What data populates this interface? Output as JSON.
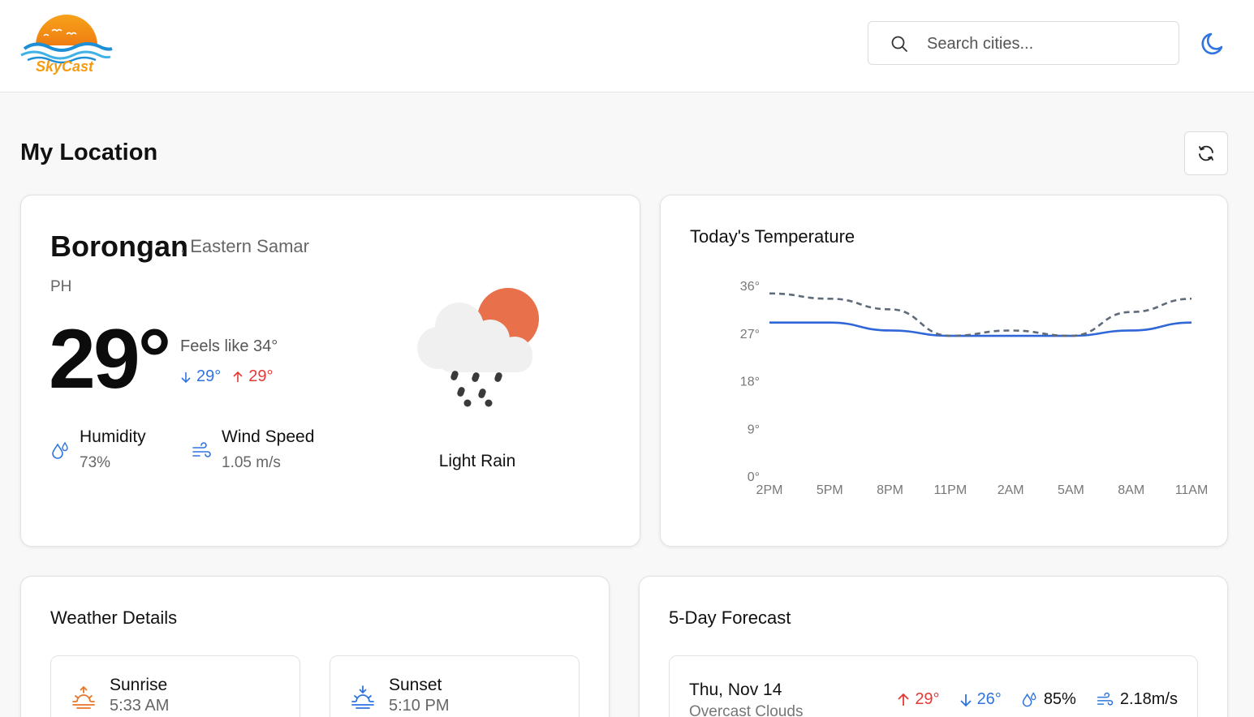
{
  "app": {
    "name": "SkyCast"
  },
  "search": {
    "placeholder": "Search cities..."
  },
  "section": {
    "title": "My Location"
  },
  "current": {
    "city": "Borongan",
    "region": ", Eastern Samar",
    "country": "PH",
    "temperature": "29°",
    "feels_like": "Feels like 34°",
    "temp_min": "29°",
    "temp_max": "29°",
    "humidity_label": "Humidity",
    "humidity_value": "73%",
    "wind_label": "Wind Speed",
    "wind_value": "1.05 m/s",
    "condition": "Light Rain"
  },
  "chart_data": {
    "type": "line",
    "title": "Today's Temperature",
    "x": [
      "2PM",
      "5PM",
      "8PM",
      "11PM",
      "2AM",
      "5AM",
      "8AM",
      "11AM"
    ],
    "yticks": [
      "36°",
      "27°",
      "18°",
      "9°",
      "0°"
    ],
    "ylim": [
      0,
      36
    ],
    "series": [
      {
        "style": "solid",
        "color": "#2f66d8",
        "values": [
          29,
          29,
          27.5,
          26.5,
          26.5,
          26.5,
          27.5,
          29
        ]
      },
      {
        "style": "dashed",
        "color": "#5f6b7a",
        "values": [
          34.5,
          33.5,
          31.5,
          26.5,
          27.5,
          26.5,
          31,
          33.5
        ]
      }
    ]
  },
  "details": {
    "title": "Weather Details",
    "sunrise_label": "Sunrise",
    "sunrise_value": "5:33 AM",
    "sunset_label": "Sunset",
    "sunset_value": "5:10 PM"
  },
  "forecast": {
    "title": "5-Day Forecast",
    "days": [
      {
        "date": "Thu, Nov 14",
        "desc": "Overcast Clouds",
        "high": "29°",
        "low": "26°",
        "humidity": "85%",
        "wind": "2.18m/s"
      }
    ]
  },
  "colors": {
    "accent": "#2f74e0",
    "hot": "#e53935",
    "sun": "#e8704a",
    "logo_orange": "#f39c12"
  }
}
